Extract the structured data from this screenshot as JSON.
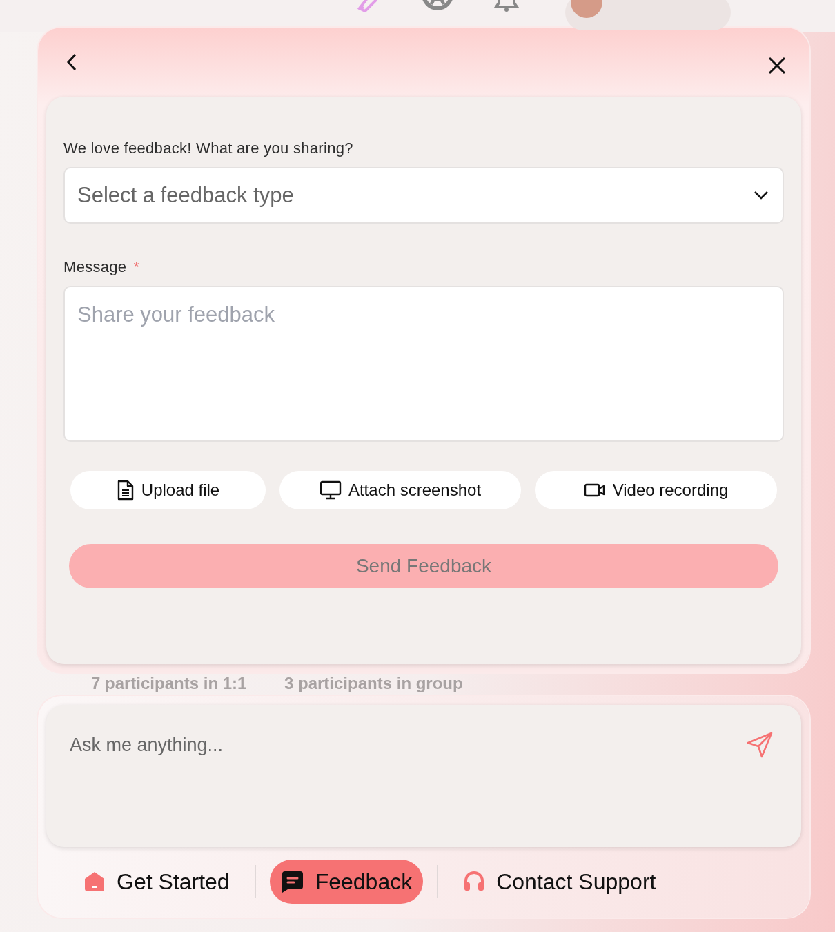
{
  "top_bar": {
    "items": [
      {
        "kind": "rocket"
      },
      {
        "kind": "help"
      },
      {
        "kind": "bell"
      }
    ],
    "user": {
      "kind": "avatar"
    }
  },
  "background": {
    "stats": [
      "7 participants in 1:1",
      "3 participants in group"
    ]
  },
  "feedback_panel": {
    "question": "We love feedback! What are you sharing?",
    "type_select": {
      "placeholder": "Select a feedback type"
    },
    "message_label": "Message",
    "required_mark": "*",
    "message": {
      "placeholder": "Share your feedback"
    },
    "attachments": [
      {
        "kind": "file",
        "label": "Upload file"
      },
      {
        "kind": "screen",
        "label": "Attach screenshot"
      },
      {
        "kind": "video",
        "label": "Video recording"
      }
    ],
    "submit": {
      "label": "Send Feedback",
      "disabled": true
    }
  },
  "chat": {
    "placeholder": "Ask me anything..."
  },
  "tabs": [
    {
      "kind": "home",
      "label": "Get Started",
      "selected": false
    },
    {
      "kind": "chat",
      "label": "Feedback",
      "selected": true
    },
    {
      "kind": "headset",
      "label": "Contact Support",
      "selected": false
    }
  ]
}
